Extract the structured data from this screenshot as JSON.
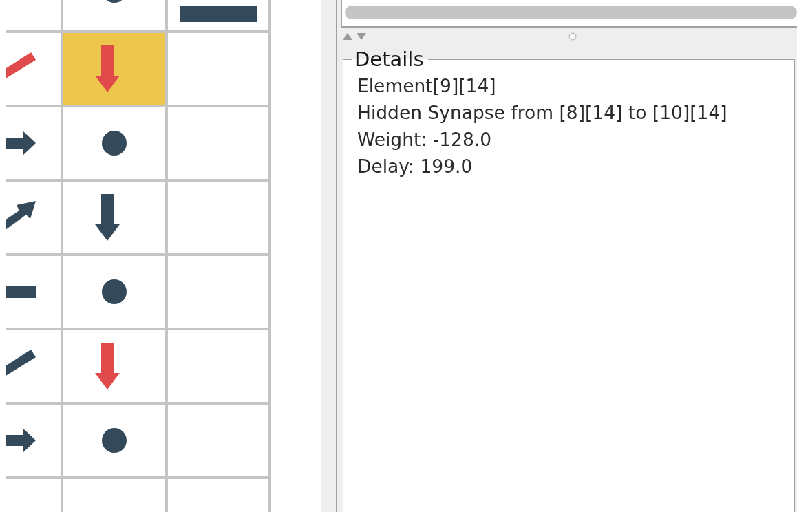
{
  "grid": {
    "rows": [
      {
        "cells": [
          {
            "kind": "empty",
            "selected": false
          },
          {
            "kind": "dot",
            "color": "#344a5a",
            "selected": false
          },
          {
            "kind": "block",
            "color": "#344a5a",
            "selected": false
          }
        ]
      },
      {
        "cells": [
          {
            "kind": "diagonal-line",
            "color": "#e04a4a",
            "selected": false
          },
          {
            "kind": "down-arrow",
            "color": "#e04a4a",
            "selected": true
          },
          {
            "kind": "empty",
            "selected": false
          }
        ]
      },
      {
        "cells": [
          {
            "kind": "right-arrow",
            "color": "#344a5a",
            "selected": false
          },
          {
            "kind": "dot",
            "color": "#344a5a",
            "selected": false
          },
          {
            "kind": "empty",
            "selected": false
          }
        ]
      },
      {
        "cells": [
          {
            "kind": "diagonal-arrow",
            "color": "#344a5a",
            "selected": false
          },
          {
            "kind": "down-arrow",
            "color": "#344a5a",
            "selected": false
          },
          {
            "kind": "empty",
            "selected": false
          }
        ]
      },
      {
        "cells": [
          {
            "kind": "bar",
            "color": "#344a5a",
            "selected": false
          },
          {
            "kind": "dot",
            "color": "#344a5a",
            "selected": false
          },
          {
            "kind": "empty",
            "selected": false
          }
        ]
      },
      {
        "cells": [
          {
            "kind": "diagonal-line",
            "color": "#344a5a",
            "selected": false
          },
          {
            "kind": "down-arrow",
            "color": "#e04a4a",
            "selected": false
          },
          {
            "kind": "empty",
            "selected": false
          }
        ]
      },
      {
        "cells": [
          {
            "kind": "right-arrow",
            "color": "#344a5a",
            "selected": false
          },
          {
            "kind": "dot",
            "color": "#344a5a",
            "selected": false
          },
          {
            "kind": "empty",
            "selected": false
          }
        ]
      },
      {
        "cells": [
          {
            "kind": "empty",
            "selected": false
          },
          {
            "kind": "empty",
            "selected": false
          },
          {
            "kind": "empty",
            "selected": false
          }
        ]
      }
    ]
  },
  "details": {
    "title": "Details",
    "lines": [
      "Element[9][14]",
      "Hidden Synapse from [8][14] to [10][14]",
      "Weight: -128.0",
      "Delay: 199.0"
    ]
  }
}
